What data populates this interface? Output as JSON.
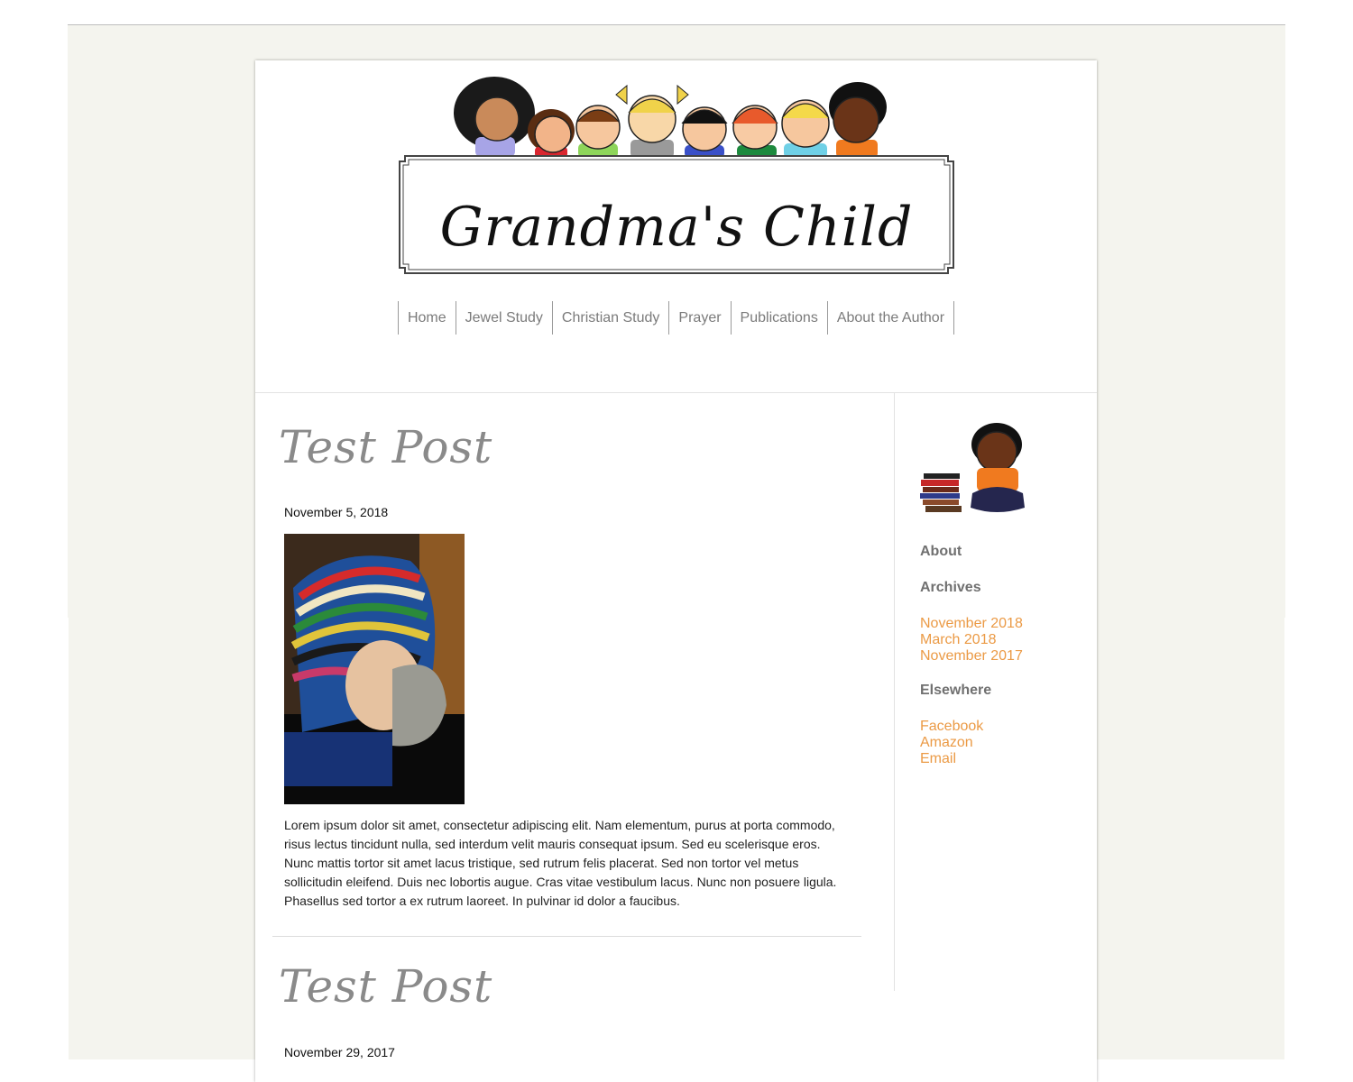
{
  "header": {
    "site_title": "Grandma's Child"
  },
  "nav": {
    "items": [
      {
        "label": "Home"
      },
      {
        "label": "Jewel Study"
      },
      {
        "label": "Christian Study"
      },
      {
        "label": "Prayer"
      },
      {
        "label": "Publications"
      },
      {
        "label": "About the Author"
      }
    ]
  },
  "posts": [
    {
      "title": "Test Post",
      "date": "November 5, 2018",
      "body": "Lorem ipsum dolor sit amet, consectetur adipiscing elit. Nam elementum, purus at porta commodo, risus lectus tincidunt nulla, sed interdum velit mauris consequat ipsum. Sed eu scelerisque eros. Nunc mattis tortor sit amet lacus tristique, sed rutrum felis placerat. Sed non tortor vel metus sollicitudin eleifend. Duis nec lobortis augue. Cras vitae vestibulum lacus. Nunc non posuere ligula. Phasellus sed tortor a ex rutrum laoreet. In pulvinar id dolor a faucibus."
    },
    {
      "title": "Test Post",
      "date": "November 29, 2017"
    }
  ],
  "sidebar": {
    "about_heading": "About",
    "archives_heading": "Archives",
    "archives": [
      "November 2018",
      "March 2018",
      "November 2017"
    ],
    "elsewhere_heading": "Elsewhere",
    "elsewhere": [
      "Facebook",
      "Amazon",
      "Email"
    ]
  },
  "colors": {
    "page_background": "#f4f4ee",
    "link": "#eb9a45",
    "nav_text": "#7b7b7b",
    "heading_gray": "#707070"
  }
}
